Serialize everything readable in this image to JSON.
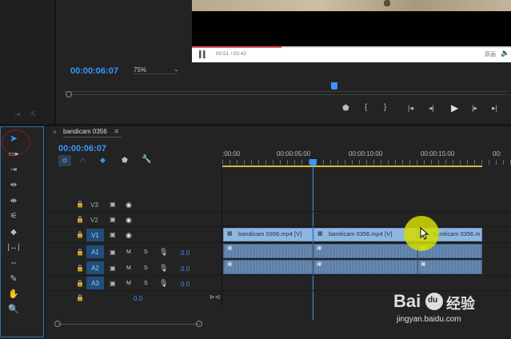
{
  "program_monitor": {
    "timecode": "00:00:06:07",
    "zoom": "75%",
    "preview": {
      "time": "00:51 / 03:42",
      "label": "原画"
    }
  },
  "sequence": {
    "name": "bandicam 0356",
    "timecode": "00:00:06:07",
    "ruler_labels": [
      ":00:00",
      "00:00:05:00",
      "00:00:10:00",
      "00:00:15:00",
      "00:"
    ]
  },
  "tracks": {
    "v3": "V3",
    "v2": "V2",
    "v1": "V1",
    "a1": "A1",
    "a2": "A2",
    "a3": "A3",
    "m": "M",
    "s": "S",
    "a1_level": "0.0",
    "a2_level": "0.0",
    "a3_level": "0.0",
    "master_level": "0.0"
  },
  "clips": {
    "clip1": "bandicam 0356.mp4 [V]",
    "clip2": "bandicam 0356.mp4 [V]",
    "clip3": "bandicam 0356.m"
  },
  "watermark": {
    "brand": "Bai",
    "paw": "du",
    "suffix": "经验",
    "url": "jingyan.baidu.com"
  },
  "colors": {
    "accent": "#3b93ff",
    "clip": "#8fb6e1",
    "audio_clip": "#5d7fa8"
  }
}
